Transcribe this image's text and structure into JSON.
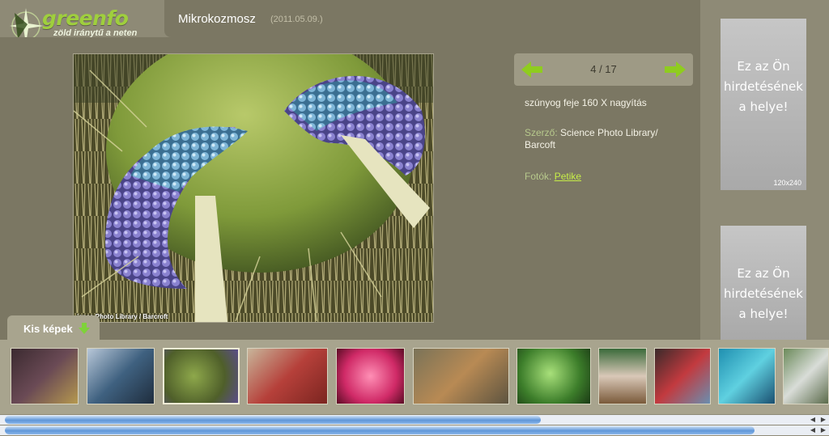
{
  "logo": {
    "word": "greenfo",
    "tagline": "zöld iránytű a neten"
  },
  "header": {
    "title": "Mikrokozmosz",
    "date": "(2011.05.09.)"
  },
  "photo": {
    "credit": "ience Photo Library / Barcroft"
  },
  "pager": {
    "counter": "4 / 17"
  },
  "info": {
    "caption": "szúnyog feje 160 X nagyítás",
    "author_label": "Szerző:",
    "author": "Science Photo Library/ Barcoft",
    "photos_label": "Fotók:",
    "photos_link": "Petike"
  },
  "ads": [
    {
      "text": "Ez az Ön hirdetésének a helye!",
      "size": "120x240"
    },
    {
      "text": "Ez az Ön hirdetésének a helye!"
    }
  ],
  "thumbnails_tab": {
    "label": "Kis képek"
  },
  "colors": {
    "accent": "#9fcf3d",
    "link": "#c7ee48",
    "panel": "#7b7763",
    "background": "#8e8a76"
  }
}
